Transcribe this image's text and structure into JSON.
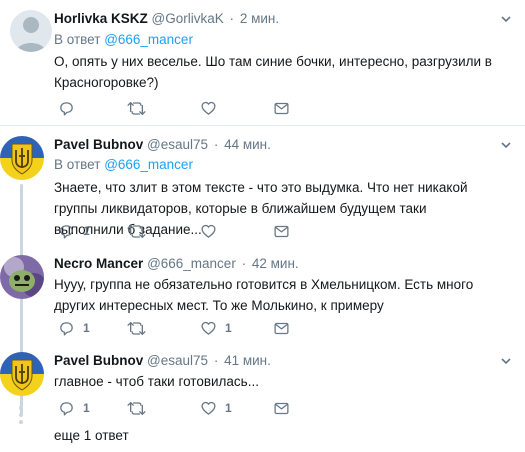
{
  "tweets": [
    {
      "name": "Horlivka KSKZ",
      "handle": "@GorlivkaK",
      "sep": "·",
      "time": "2 мин.",
      "reply_prefix": "В ответ",
      "reply_mention": "@666_mancer",
      "text": "О, опять у них веселье. Шо там синие бочки, интересно, разгрузили в Красногоровке?)",
      "avatar": "default-egg-avatar"
    },
    {
      "name": "Pavel Bubnov",
      "handle": "@esaul75",
      "sep": "·",
      "time": "44 мин.",
      "reply_prefix": "В ответ",
      "reply_mention": "@666_mancer",
      "text": "Знаете, что злит в этом тексте - что это выдумка. Что нет никакой группы ликвидаторов, которые в ближайшем будущем таки выполнили б задание...",
      "reply_count": "1",
      "avatar": "trident-shield-avatar"
    },
    {
      "name": "Necro Mancer",
      "handle": "@666_mancer",
      "sep": "·",
      "time": "42 мин.",
      "text": "Нууу, группа не обязательно готовится в Хмельницком. Есть много других интересных мест. То же Молькино, к примеру",
      "reply_count": "1",
      "like_count": "1",
      "avatar": "monster-avatar"
    },
    {
      "name": "Pavel Bubnov",
      "handle": "@esaul75",
      "sep": "·",
      "time": "41 мин.",
      "text": "главное - чтоб таки готовилась...",
      "reply_count": "1",
      "like_count": "1",
      "avatar": "trident-shield-avatar"
    }
  ],
  "more_replies": "еще 1 ответ",
  "colors": {
    "accent": "#1da1f2",
    "muted": "#657786",
    "divider": "#e6ecf0",
    "thread_line": "#ccd6dd"
  }
}
